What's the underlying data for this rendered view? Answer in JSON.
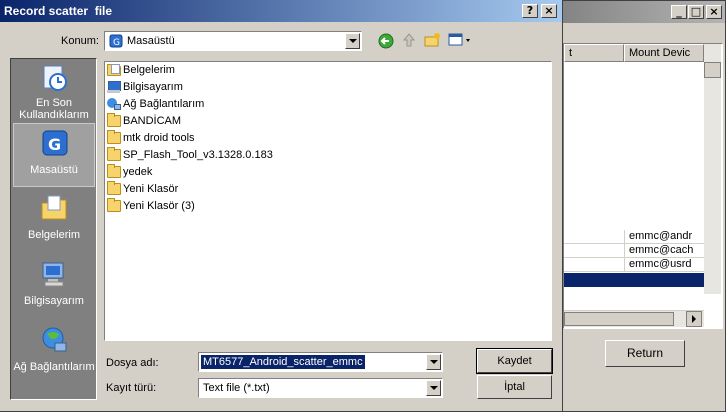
{
  "background_window": {
    "columns": [
      "t",
      "Mount Devic"
    ],
    "rows": [
      {
        "col2": "emmc@andr"
      },
      {
        "col2": "emmc@cach"
      },
      {
        "col2": "emmc@usrd"
      }
    ],
    "return_label": "Return"
  },
  "dialog": {
    "title": "Record scatter  file",
    "help_glyph": "?",
    "close_glyph": "×",
    "location_label": "Konum:",
    "location_value": "Masaüstü",
    "places": [
      {
        "label": "En Son Kullandıklarım",
        "icon": "recent-clock-icon"
      },
      {
        "label": "Masaüstü",
        "icon": "desktop-icon",
        "selected": true
      },
      {
        "label": "Belgelerim",
        "icon": "documents-folder-icon"
      },
      {
        "label": "Bilgisayarım",
        "icon": "computer-icon"
      },
      {
        "label": "Ağ Bağlantılarım",
        "icon": "network-icon"
      }
    ],
    "files": [
      {
        "name": "Belgelerim",
        "icon": "documents-folder-icon"
      },
      {
        "name": "Bilgisayarım",
        "icon": "computer-icon"
      },
      {
        "name": "Ağ Bağlantılarım",
        "icon": "network-icon"
      },
      {
        "name": "BANDİCAM",
        "icon": "folder-icon"
      },
      {
        "name": "mtk droid tools",
        "icon": "folder-icon"
      },
      {
        "name": "SP_Flash_Tool_v3.1328.0.183",
        "icon": "folder-icon"
      },
      {
        "name": "yedek",
        "icon": "folder-icon"
      },
      {
        "name": "Yeni Klasör",
        "icon": "folder-icon"
      },
      {
        "name": "Yeni Klasör (3)",
        "icon": "folder-icon"
      }
    ],
    "filename_label": "Dosya adı:",
    "filename_value": "MT6577_Android_scatter_emmc",
    "filetype_label": "Kayıt türü:",
    "filetype_value": "Text file (*.txt)",
    "save_label": "Kaydet",
    "cancel_label": "İptal"
  }
}
